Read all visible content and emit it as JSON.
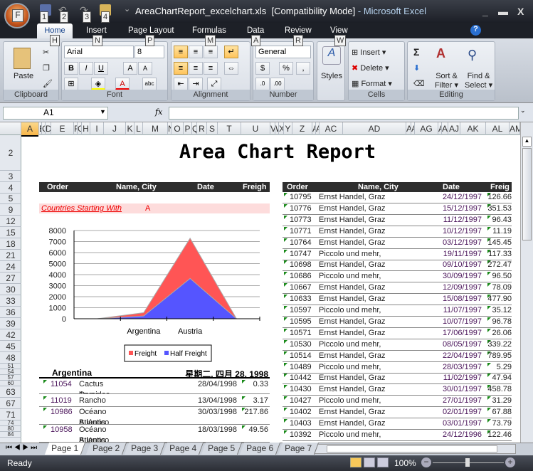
{
  "window": {
    "title": "AreaChartReport_excelchart.xls",
    "mode": "[Compatibility Mode]",
    "app": "- Microsoft Excel"
  },
  "keytips": {
    "office": "F",
    "qat": [
      "1",
      "2",
      "3",
      "4"
    ],
    "tabs": [
      "H",
      "N",
      "P",
      "M",
      "A",
      "R",
      "W"
    ]
  },
  "ribbon": {
    "tabs": [
      "Home",
      "Insert",
      "Page Layout",
      "Formulas",
      "Data",
      "Review",
      "View"
    ],
    "clipboard": {
      "label": "Clipboard",
      "paste": "Paste"
    },
    "font": {
      "label": "Font",
      "name": "Arial",
      "size": "8",
      "bold": "B",
      "italic": "I",
      "underline": "U"
    },
    "alignment": {
      "label": "Alignment"
    },
    "number": {
      "label": "Number",
      "format": "General",
      "percent": "%",
      "comma": ","
    },
    "styles": {
      "label": "Styles"
    },
    "cells": {
      "label": "Cells",
      "insert": "Insert",
      "delete": "Delete",
      "format": "Format"
    },
    "editing": {
      "label": "Editing",
      "sort": "Sort &",
      "filter": "Filter",
      "find": "Find &",
      "select": "Select",
      "sum": "Σ"
    }
  },
  "formula_bar": {
    "name_box": "A1",
    "fx": "fx",
    "value": ""
  },
  "columns": [
    "A",
    "B",
    "C",
    "D",
    "E",
    "F",
    "G",
    "H",
    "I",
    "J",
    "K",
    "L",
    "M",
    "N",
    "O",
    "P",
    "Q",
    "R",
    "S",
    "T",
    "U",
    "V",
    "W",
    "X",
    "Y",
    "Z",
    "AA",
    "AB",
    "AC",
    "AD",
    "AE",
    "AF",
    "AG",
    "AH",
    "AI",
    "AJ",
    "AK",
    "AL",
    "AM"
  ],
  "rows": [
    "2",
    "3",
    "4",
    "5",
    "9",
    "12",
    "15",
    "18",
    "21",
    "24",
    "27",
    "30",
    "33",
    "36",
    "39",
    "42",
    "45",
    "48",
    "51",
    "54",
    "57",
    "60",
    "63",
    "67",
    "71",
    "74",
    "80",
    "84"
  ],
  "report": {
    "title": "Area Chart Report",
    "left_header": {
      "order": "Order",
      "name": "Name, City",
      "date": "Date",
      "freight": "Freigh"
    },
    "filter": {
      "label": "Countries Starting With",
      "value": "A"
    },
    "group": {
      "country": "Argentina",
      "date": "星期二, 四月 28, 1998"
    },
    "left_rows": [
      {
        "order": "11054",
        "name": "Cactus Comidas para",
        "name2": "llaves, Buenos Aires",
        "date": "28/04/1998",
        "freight": "0.33"
      },
      {
        "order": "11019",
        "name": "Rancho grande, Buenos",
        "name2": "",
        "date": "13/04/1998",
        "freight": "3.17"
      },
      {
        "order": "10986",
        "name": "Océano Atlántico Ltda.,",
        "name2": "Buenos Aires",
        "date": "30/03/1998",
        "freight": "217.86"
      },
      {
        "order": "10958",
        "name": "Océano Atlántico Ltda.,",
        "name2": "Buenos Aires",
        "date": "18/03/1998",
        "freight": "49.56"
      }
    ],
    "right_header": {
      "order": "Order",
      "name": "Name, City",
      "date": "Date",
      "freight": "Freig"
    },
    "right_rows": [
      {
        "order": "10795",
        "name": "Ernst Handel, Graz",
        "date": "24/12/1997",
        "freight": "126.66"
      },
      {
        "order": "10776",
        "name": "Ernst Handel, Graz",
        "date": "15/12/1997",
        "freight": "351.53"
      },
      {
        "order": "10773",
        "name": "Ernst Handel, Graz",
        "date": "11/12/1997",
        "freight": "96.43"
      },
      {
        "order": "10771",
        "name": "Ernst Handel, Graz",
        "date": "10/12/1997",
        "freight": "11.19"
      },
      {
        "order": "10764",
        "name": "Ernst Handel, Graz",
        "date": "03/12/1997",
        "freight": "145.45"
      },
      {
        "order": "10747",
        "name": "Piccolo und mehr,",
        "date": "19/11/1997",
        "freight": "117.33"
      },
      {
        "order": "10698",
        "name": "Ernst Handel, Graz",
        "date": "09/10/1997",
        "freight": "272.47"
      },
      {
        "order": "10686",
        "name": "Piccolo und mehr,",
        "date": "30/09/1997",
        "freight": "96.50"
      },
      {
        "order": "10667",
        "name": "Ernst Handel, Graz",
        "date": "12/09/1997",
        "freight": "78.09"
      },
      {
        "order": "10633",
        "name": "Ernst Handel, Graz",
        "date": "15/08/1997",
        "freight": "477.90"
      },
      {
        "order": "10597",
        "name": "Piccolo und mehr,",
        "date": "11/07/1997",
        "freight": "35.12"
      },
      {
        "order": "10595",
        "name": "Ernst Handel, Graz",
        "date": "10/07/1997",
        "freight": "96.78"
      },
      {
        "order": "10571",
        "name": "Ernst Handel, Graz",
        "date": "17/06/1997",
        "freight": "26.06"
      },
      {
        "order": "10530",
        "name": "Piccolo und mehr,",
        "date": "08/05/1997",
        "freight": "339.22"
      },
      {
        "order": "10514",
        "name": "Ernst Handel, Graz",
        "date": "22/04/1997",
        "freight": "789.95"
      },
      {
        "order": "10489",
        "name": "Piccolo und mehr,",
        "date": "28/03/1997",
        "freight": "5.29"
      },
      {
        "order": "10442",
        "name": "Ernst Handel, Graz",
        "date": "11/02/1997",
        "freight": "47.94"
      },
      {
        "order": "10430",
        "name": "Ernst Handel, Graz",
        "date": "30/01/1997",
        "freight": "458.78"
      },
      {
        "order": "10427",
        "name": "Piccolo und mehr,",
        "date": "27/01/1997",
        "freight": "31.29"
      },
      {
        "order": "10402",
        "name": "Ernst Handel, Graz",
        "date": "02/01/1997",
        "freight": "67.88"
      },
      {
        "order": "10403",
        "name": "Ernst Handel, Graz",
        "date": "03/01/1997",
        "freight": "73.79"
      },
      {
        "order": "10392",
        "name": "Piccolo und mehr,",
        "date": "24/12/1996",
        "freight": "122.46"
      }
    ]
  },
  "chart_data": {
    "type": "area",
    "stacked": false,
    "categories": [
      "",
      "Argentina",
      "Austria",
      ""
    ],
    "series": [
      {
        "name": "Freight",
        "values": [
          0,
          550,
          7300,
          0
        ],
        "color": "#ff5555"
      },
      {
        "name": "Half Freight",
        "values": [
          0,
          250,
          3650,
          0
        ],
        "color": "#5555ff"
      }
    ],
    "ylim": [
      0,
      8000
    ],
    "yticks": [
      "0",
      "1000",
      "2000",
      "3000",
      "4000",
      "5000",
      "6000",
      "7000",
      "8000"
    ],
    "grid": true,
    "legend": "bottom"
  },
  "sheet_tabs": [
    "Page 1",
    "Page 2",
    "Page 3",
    "Page 4",
    "Page 5",
    "Page 6",
    "Page 7"
  ],
  "status": {
    "text": "Ready",
    "zoom": "100%"
  }
}
